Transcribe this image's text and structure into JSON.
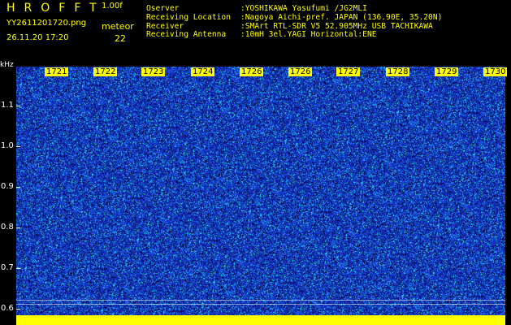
{
  "header": {
    "logo": "HROFFT",
    "version": "1.00f",
    "filename": "YY2611201720.png",
    "datetime": "26.11.20 17:20",
    "meteor_label": "meteor",
    "meteor_count": "22"
  },
  "meta": [
    {
      "key": "Oserver",
      "value": ":YOSHIKAWA Yasufumi /JG2MLI"
    },
    {
      "key": "Receiving Location",
      "value": ":Nagoya Aichi-pref. JAPAN (136.90E, 35.20N)"
    },
    {
      "key": "Receiver",
      "value": ":SMArt RTL-SDR V5 52.905MHz USB TACHIKAWA"
    },
    {
      "key": "Receiving Antenna",
      "value": ":10mH 3el.YAGI Horizontal:ENE"
    }
  ],
  "axis": {
    "unit": "kHz",
    "labels": [
      "1.1",
      "1.0",
      "0.9",
      "0.8",
      "0.7",
      "0.6"
    ]
  },
  "time_labels": [
    "1721",
    "1722",
    "1723",
    "1724",
    "1726",
    "1726",
    "1727",
    "1728",
    "1729",
    "1730"
  ],
  "colors": {
    "background": "#000000",
    "text": "#ffff00",
    "spectrogram_base": "#0a1f8a",
    "noise_cyan": "#20e0e0",
    "noise_blue": "#2040ff"
  }
}
